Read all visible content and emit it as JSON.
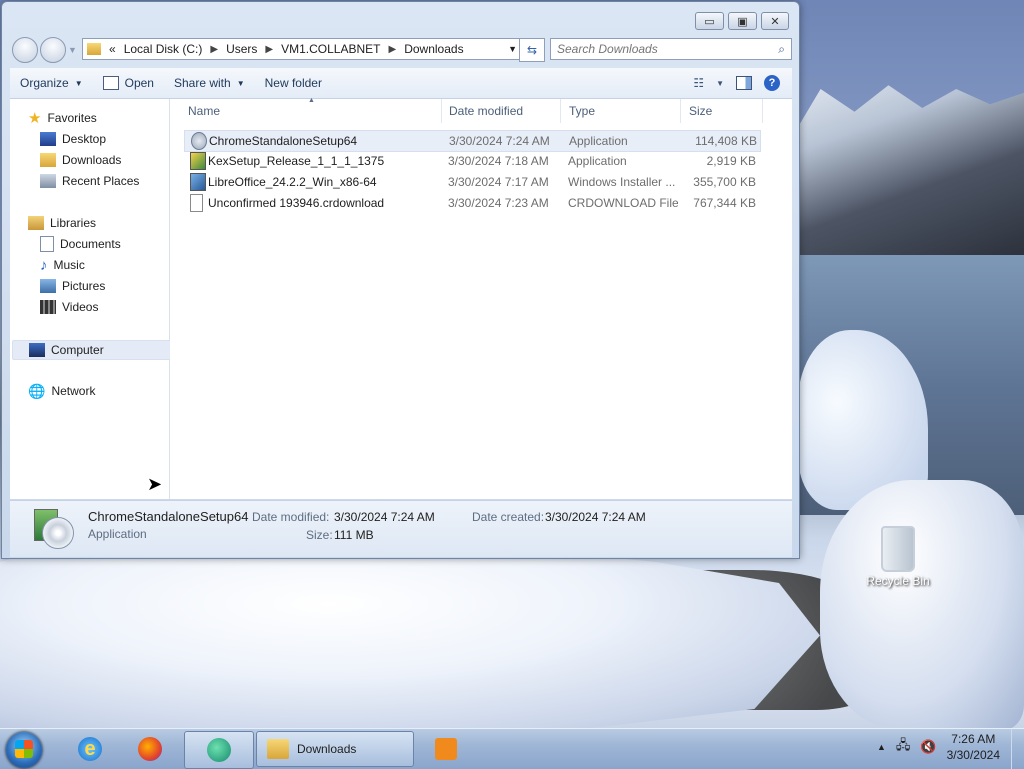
{
  "window": {
    "breadcrumb": [
      "Local Disk (C:)",
      "Users",
      "VM1.COLLABNET",
      "Downloads"
    ],
    "breadcrumb_prefix": "«",
    "search_placeholder": "Search Downloads",
    "controls": {
      "minimize": "▭",
      "maximize": "▣",
      "close": "✕"
    }
  },
  "toolbar": {
    "organize": "Organize",
    "open": "Open",
    "share_with": "Share with",
    "new_folder": "New folder"
  },
  "navpane": {
    "favorites": "Favorites",
    "favorites_items": [
      "Desktop",
      "Downloads",
      "Recent Places"
    ],
    "libraries": "Libraries",
    "libraries_items": [
      "Documents",
      "Music",
      "Pictures",
      "Videos"
    ],
    "computer": "Computer",
    "network": "Network"
  },
  "columns": {
    "name": "Name",
    "date": "Date modified",
    "type": "Type",
    "size": "Size"
  },
  "files": [
    {
      "name": "ChromeStandaloneSetup64",
      "date": "3/30/2024 7:24 AM",
      "type": "Application",
      "size": "114,408 KB"
    },
    {
      "name": "KexSetup_Release_1_1_1_1375",
      "date": "3/30/2024 7:18 AM",
      "type": "Application",
      "size": "2,919 KB"
    },
    {
      "name": "LibreOffice_24.2.2_Win_x86-64",
      "date": "3/30/2024 7:17 AM",
      "type": "Windows Installer ...",
      "size": "355,700 KB"
    },
    {
      "name": "Unconfirmed 193946.crdownload",
      "date": "3/30/2024 7:23 AM",
      "type": "CRDOWNLOAD File",
      "size": "767,344 KB"
    }
  ],
  "details": {
    "name": "ChromeStandaloneSetup64",
    "type": "Application",
    "date_modified_label": "Date modified:",
    "date_modified": "3/30/2024 7:24 AM",
    "date_created_label": "Date created:",
    "date_created": "3/30/2024 7:24 AM",
    "size_label": "Size:",
    "size": "111 MB"
  },
  "desktop": {
    "recycle_bin": "Recycle Bin"
  },
  "taskbar": {
    "active_window": "Downloads",
    "time": "7:26 AM",
    "date": "3/30/2024"
  }
}
